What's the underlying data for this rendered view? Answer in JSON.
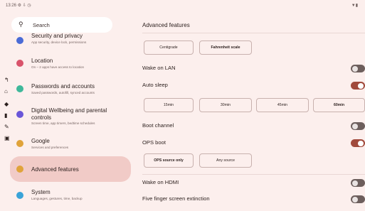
{
  "statusbar": {
    "time": "13:26 ⚙ ⇩ ◷",
    "right": "▼▮",
    "icons": [
      "settings-icon",
      "download-icon",
      "timer-icon",
      "wifi-icon",
      "battery-icon"
    ]
  },
  "search": {
    "label": "Search",
    "icon": "search-icon"
  },
  "sidebar": {
    "items": [
      {
        "title": "Security and privacy",
        "sub": "App security, device lock, permissions",
        "color": "#4a6bd6"
      },
      {
        "title": "Location",
        "sub": "On – 2 apps have access to location",
        "color": "#d9536b"
      },
      {
        "title": "Passwords and accounts",
        "sub": "Saved passwords, autofill, synced accounts",
        "color": "#3fb89a"
      },
      {
        "title": "Digital Wellbeing and parental controls",
        "sub": "Screen time, app timers, bedtime schedules",
        "color": "#6a56d8"
      },
      {
        "title": "Google",
        "sub": "Services and preferences",
        "color": "#e0a33a"
      },
      {
        "title": "Advanced features",
        "sub": "",
        "color": "#e0a33a"
      },
      {
        "title": "System",
        "sub": "Languages, gestures, time, backup",
        "color": "#3aa3d8"
      }
    ]
  },
  "rail": {
    "icons": [
      "back-icon",
      "home-icon",
      "layers-icon",
      "notes-icon",
      "edit-icon",
      "briefcase-icon"
    ]
  },
  "main": {
    "heading": "Advanced features",
    "temp_options": [
      "Centigrade",
      "Fahrenheit scale"
    ],
    "rows": {
      "wake_lan": "Wake on LAN",
      "auto_sleep": "Auto sleep",
      "boot_channel": "Boot channel",
      "ops_boot": "OPS boot",
      "wake_hdmi": "Wake on HDMI",
      "five_finger": "Five finger screen extinction"
    },
    "sleep_options": [
      "15min",
      "30min",
      "45min",
      "60min"
    ],
    "source_options": [
      "OPS source only",
      "Any source"
    ],
    "toggles": {
      "wake_lan": false,
      "auto_sleep": true,
      "boot_channel": false,
      "ops_boot": true,
      "wake_hdmi": false,
      "five_finger": false
    },
    "accent": "#a14a3c"
  }
}
